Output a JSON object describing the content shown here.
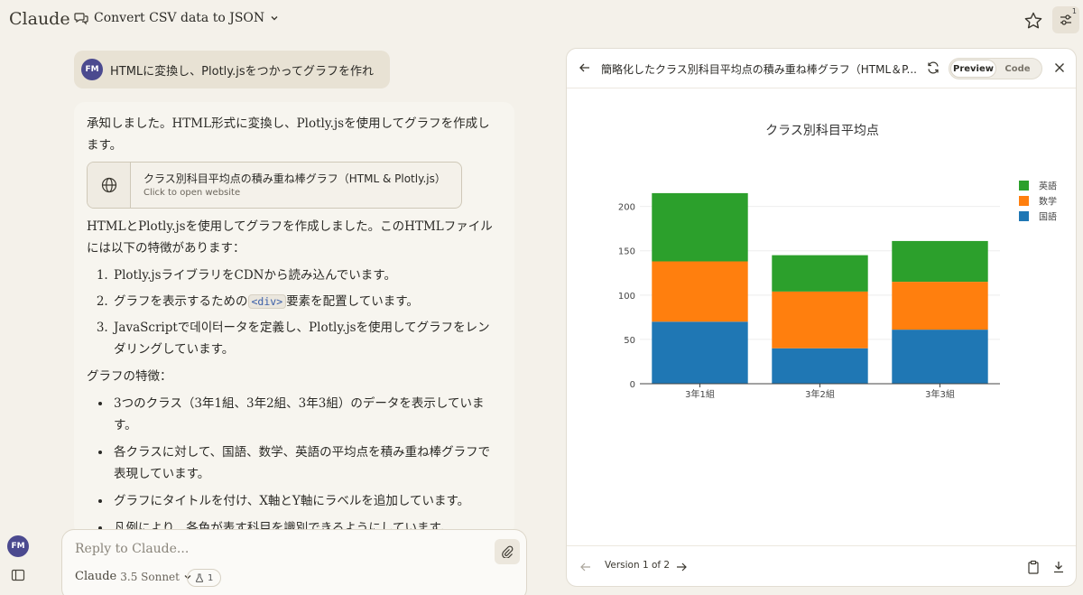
{
  "app": {
    "brand": "Claude",
    "conversation_title": "Convert CSV data to JSON",
    "settings_badge": "1",
    "user_initials": "FM"
  },
  "user_message": {
    "initials": "FM",
    "text": "HTMLに変換し、Plotly.jsをつかってグラフを作れ"
  },
  "assistant": {
    "intro": "承知しました。HTML形式に変換し、Plotly.jsを使用してグラフを作成します。",
    "artifact_card": {
      "title": "クラス別科目平均点の積み重ね棒グラフ（HTML & Plotly.js）",
      "subtitle": "Click to open website"
    },
    "summary": "HTMLとPlotly.jsを使用してグラフを作成しました。このHTMLファイルには以下の特徴があります：",
    "features": {
      "f1": "Plotly.jsライブラリをCDNから読み込んでいます。",
      "f2_before": "グラフを表示するための",
      "f2_code": "<div>",
      "f2_after": "要素を配置しています。",
      "f3": "JavaScriptで데이터ータを定義し、Plotly.jsを使用してグラフをレンダリングしています。"
    },
    "traits_heading": "グラフの特徴：",
    "traits": [
      "3つのクラス（3年1組、3年2組、3年3組）のデータを表示しています。",
      "各クラスに対して、国語、数学、英語の平均点を積み重ね棒グラフで表現しています。",
      "グラフにタイトルを付け、X軸とY軸にラベルを追加しています。",
      "凡例により、各色が表す科目を識別できるようにしています。"
    ]
  },
  "reply": {
    "placeholder": "Reply to Claude...",
    "model_name": "Claude",
    "model_version": "3.5 Sonnet",
    "project_count": "1"
  },
  "panel": {
    "title": "簡略化したクラス別科目平均点の積み重ね棒グラフ（HTML＆P...",
    "preview_label": "Preview",
    "code_label": "Code",
    "version_label": "Version 1 of 2"
  },
  "chart_data": {
    "type": "bar",
    "stacked": true,
    "title": "クラス別科目平均点",
    "xlabel": "",
    "ylabel": "",
    "categories": [
      "3年1組",
      "3年2組",
      "3年3組"
    ],
    "series": [
      {
        "name": "国語",
        "color": "#1f77b4",
        "values": [
          70,
          40,
          61
        ]
      },
      {
        "name": "数学",
        "color": "#ff7f0e",
        "values": [
          68,
          64,
          54
        ]
      },
      {
        "name": "英語",
        "color": "#2ca02c",
        "values": [
          77,
          41,
          46
        ]
      }
    ],
    "ylim": [
      0,
      220
    ],
    "yticks": [
      0,
      50,
      100,
      150,
      200
    ],
    "grid": true,
    "legend": "top-right"
  }
}
